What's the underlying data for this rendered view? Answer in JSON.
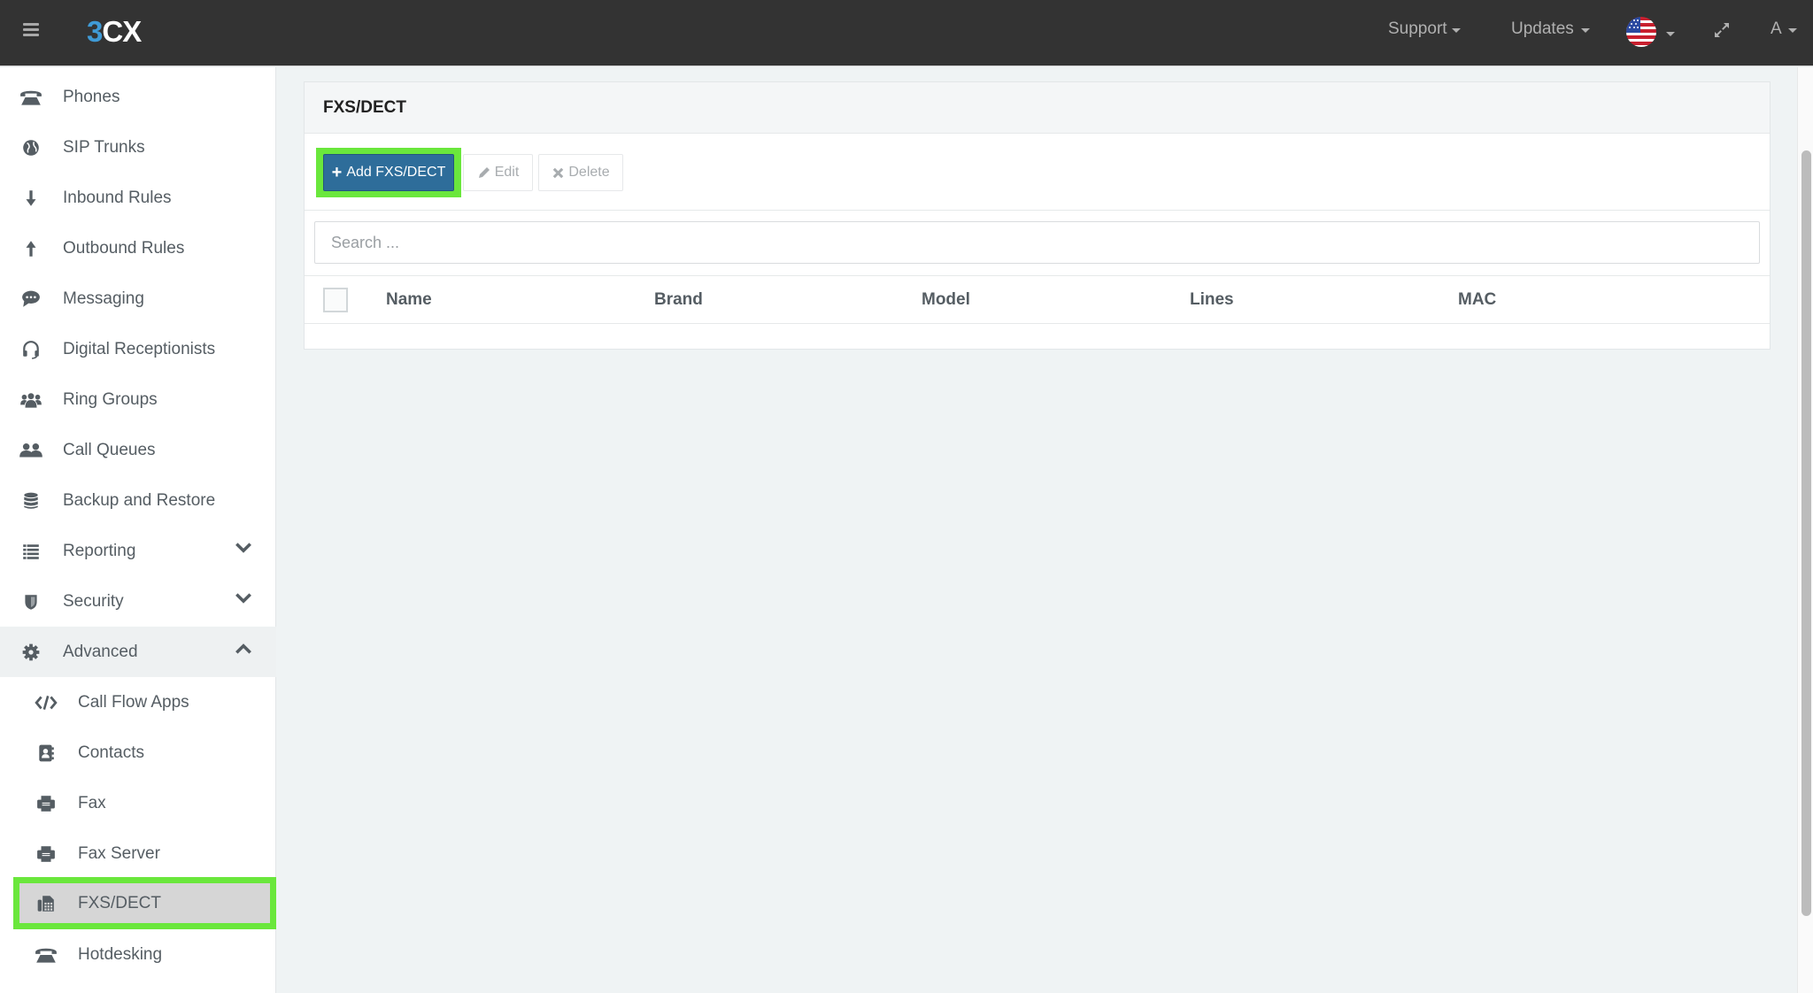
{
  "topbar": {
    "menu_icon": "hamburger-icon",
    "logo_prefix": "3",
    "logo_suffix": "CX",
    "nav": [
      {
        "label": "Support",
        "icon": "caret-down-icon"
      },
      {
        "label": "Updates",
        "icon": "caret-down-icon"
      }
    ],
    "language_icon": "us-flag-icon",
    "fullscreen_icon": "expand-icon",
    "user_label": "A"
  },
  "sidebar": {
    "items": [
      {
        "label": "Phones",
        "icon": "phone-icon"
      },
      {
        "label": "SIP Trunks",
        "icon": "globe-icon"
      },
      {
        "label": "Inbound Rules",
        "icon": "arrow-down-icon"
      },
      {
        "label": "Outbound Rules",
        "icon": "arrow-up-icon"
      },
      {
        "label": "Messaging",
        "icon": "chat-icon"
      },
      {
        "label": "Digital Receptionists",
        "icon": "headset-icon"
      },
      {
        "label": "Ring Groups",
        "icon": "group-icon"
      },
      {
        "label": "Call Queues",
        "icon": "users-icon"
      },
      {
        "label": "Backup and Restore",
        "icon": "database-icon"
      },
      {
        "label": "Reporting",
        "icon": "list-icon",
        "expandable": true,
        "expanded": false
      },
      {
        "label": "Security",
        "icon": "shield-icon",
        "expandable": true,
        "expanded": false
      },
      {
        "label": "Advanced",
        "icon": "gear-icon",
        "expandable": true,
        "expanded": true
      }
    ],
    "advanced_children": [
      {
        "label": "Call Flow Apps",
        "icon": "code-icon"
      },
      {
        "label": "Contacts",
        "icon": "address-book-icon"
      },
      {
        "label": "Fax",
        "icon": "fax-icon"
      },
      {
        "label": "Fax Server",
        "icon": "fax-icon"
      },
      {
        "label": "FXS/DECT",
        "icon": "fax-machine-icon",
        "selected": true
      },
      {
        "label": "Hotdesking",
        "icon": "phone-icon"
      }
    ]
  },
  "main": {
    "title": "FXS/DECT",
    "toolbar": {
      "add_label": "Add FXS/DECT",
      "edit_label": "Edit",
      "delete_label": "Delete"
    },
    "search": {
      "placeholder": "Search ...",
      "value": ""
    },
    "table": {
      "columns": [
        "Name",
        "Brand",
        "Model",
        "Lines",
        "MAC"
      ],
      "rows": []
    }
  },
  "colors": {
    "topbar_bg": "#333333",
    "logo_accent": "#3f9ad6",
    "primary_button": "#2e6d9a",
    "highlight_outline": "#6ae73c",
    "selected_item_bg": "#d6d6d6"
  }
}
